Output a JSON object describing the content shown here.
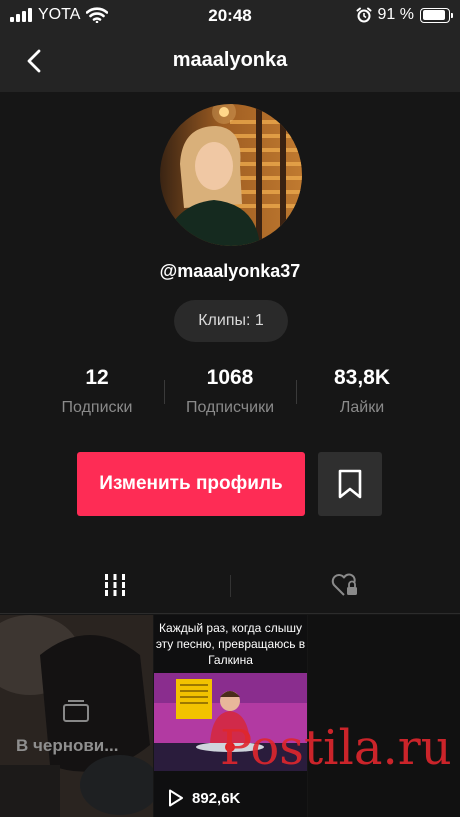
{
  "status_bar": {
    "carrier": "YOTA",
    "time": "20:48",
    "battery_text": "91 %",
    "battery_level": 0.91
  },
  "nav": {
    "title": "maaalyonka"
  },
  "profile": {
    "handle": "@maaalyonka37",
    "clips_label": "Клипы: 1",
    "stats": [
      {
        "value": "12",
        "label": "Подписки"
      },
      {
        "value": "1068",
        "label": "Подписчики"
      },
      {
        "value": "83,8K",
        "label": "Лайки"
      }
    ],
    "edit_button": "Изменить профиль"
  },
  "tabs": [
    {
      "icon": "grid-icon",
      "active": true
    },
    {
      "icon": "liked-private-icon",
      "active": false
    }
  ],
  "videos": [
    {
      "type": "draft",
      "label": "В чернови..."
    },
    {
      "type": "video",
      "caption": "Каждый раз, когда слышу эту песню, превращаюсь в Галкина",
      "views": "892,6K"
    }
  ],
  "watermark": "Postila.ru",
  "colors": {
    "accent": "#fe2c55",
    "background": "#161616",
    "bar": "#242424"
  }
}
